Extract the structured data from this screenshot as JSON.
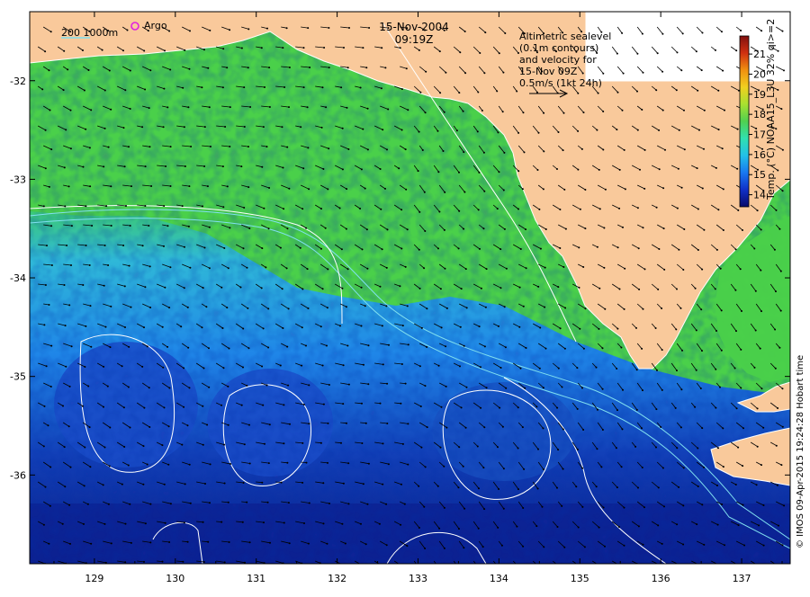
{
  "header": {
    "date": "15-Nov-2004",
    "time": "09:19Z"
  },
  "legend": {
    "isobath_label": "200  1000m",
    "argo_label": "Argo"
  },
  "annotation": {
    "lines": [
      "Altimetric sealevel",
      "(0.1m contours)",
      "and velocity for",
      "15-Nov 09Z",
      "0.5m/s (1kt 24h)"
    ]
  },
  "colorbar": {
    "label": "Temp. (°C) NOAA15_L3U 32% qi>=2",
    "ticks": [
      14,
      15,
      16,
      17,
      18,
      19,
      20,
      21
    ],
    "min": 13.4,
    "max": 21.9,
    "colors": [
      "#0a0a6a",
      "#1030c8",
      "#1878f0",
      "#22c0e8",
      "#30e0b0",
      "#50d050",
      "#a8e030",
      "#f0d020",
      "#f09010",
      "#d03010",
      "#801010"
    ]
  },
  "axes": {
    "x_ticks": [
      129,
      130,
      131,
      132,
      133,
      134,
      135,
      136,
      137
    ],
    "y_ticks": [
      -32,
      -33,
      -34,
      -35,
      -36
    ],
    "lon_range": [
      128.2,
      137.6
    ],
    "lat_range": [
      -36.9,
      -31.3
    ]
  },
  "credit": "© IMOS 09-Apr-2015 19:24:28 Hobart time",
  "colors": {
    "land": "#f9c99b",
    "warm_water": "#4cd24c",
    "cool_water": "#1a5ad0",
    "deep_cool": "#0c1e8c"
  }
}
